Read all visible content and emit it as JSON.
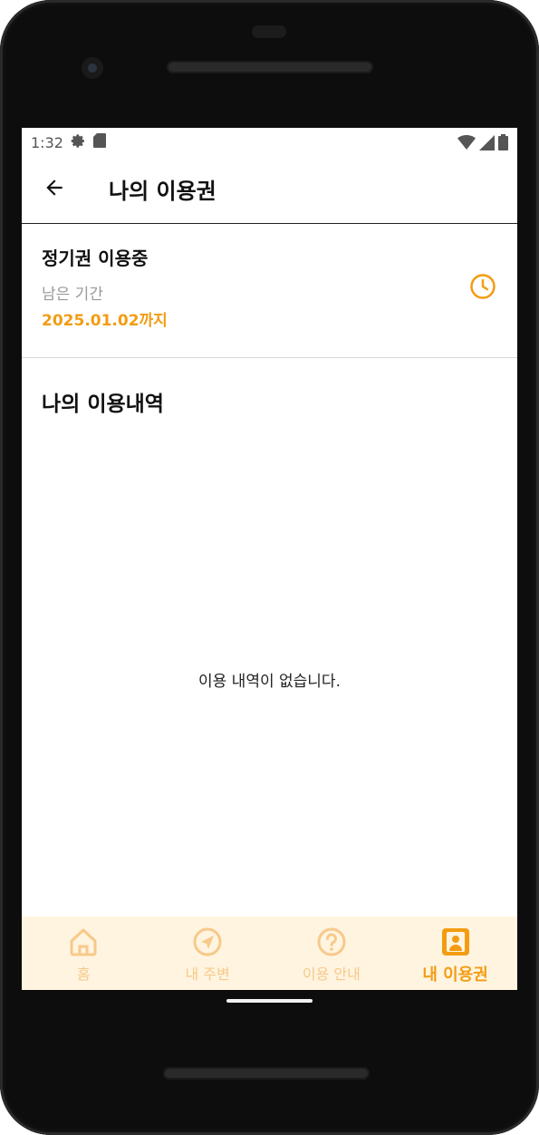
{
  "status_bar": {
    "time": "1:32",
    "icons": [
      "gear-icon",
      "sd-card-icon",
      "wifi-icon",
      "signal-icon",
      "battery-icon"
    ]
  },
  "app_bar": {
    "title": "나의 이용권",
    "back_icon": "arrow-left-icon"
  },
  "pass": {
    "status": "정기권 이용중",
    "remaining_label": "남은 기간",
    "until": "2025.01.02까지",
    "icon": "clock-icon"
  },
  "history": {
    "title": "나의 이용내역",
    "empty_message": "이용 내역이 없습니다."
  },
  "bottom_nav": {
    "items": [
      {
        "label": "홈",
        "icon": "home-icon",
        "active": false
      },
      {
        "label": "내 주변",
        "icon": "navigation-icon",
        "active": false
      },
      {
        "label": "이용 안내",
        "icon": "help-icon",
        "active": false
      },
      {
        "label": "내 이용권",
        "icon": "pass-card-icon",
        "active": true
      }
    ]
  },
  "colors": {
    "accent": "#f39c12",
    "accent_light": "#f7c98a",
    "nav_background": "#fff4e0"
  }
}
